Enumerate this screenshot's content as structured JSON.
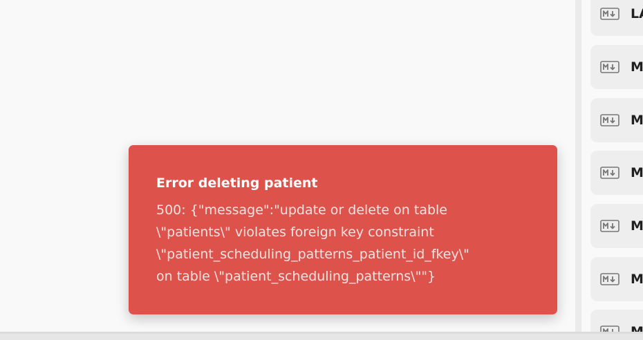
{
  "toast": {
    "title": "Error deleting patient",
    "message": "500: {\"message\":\"update or delete on table\n\\\"patients\\\" violates foreign key constraint\n\\\"patient_scheduling_patterns_patient_id_fkey\\\"\non table \\\"patient_scheduling_patterns\\\"\"}",
    "color": "#dd534b"
  },
  "file_list": {
    "items": [
      {
        "icon": "markdown-icon",
        "label": "LA"
      },
      {
        "icon": "markdown-icon",
        "label": "M"
      },
      {
        "icon": "markdown-icon",
        "label": "M"
      },
      {
        "icon": "markdown-icon",
        "label": "M"
      },
      {
        "icon": "markdown-icon",
        "label": "M"
      },
      {
        "icon": "markdown-icon",
        "label": "M"
      },
      {
        "icon": "markdown-icon",
        "label": "M"
      }
    ]
  }
}
